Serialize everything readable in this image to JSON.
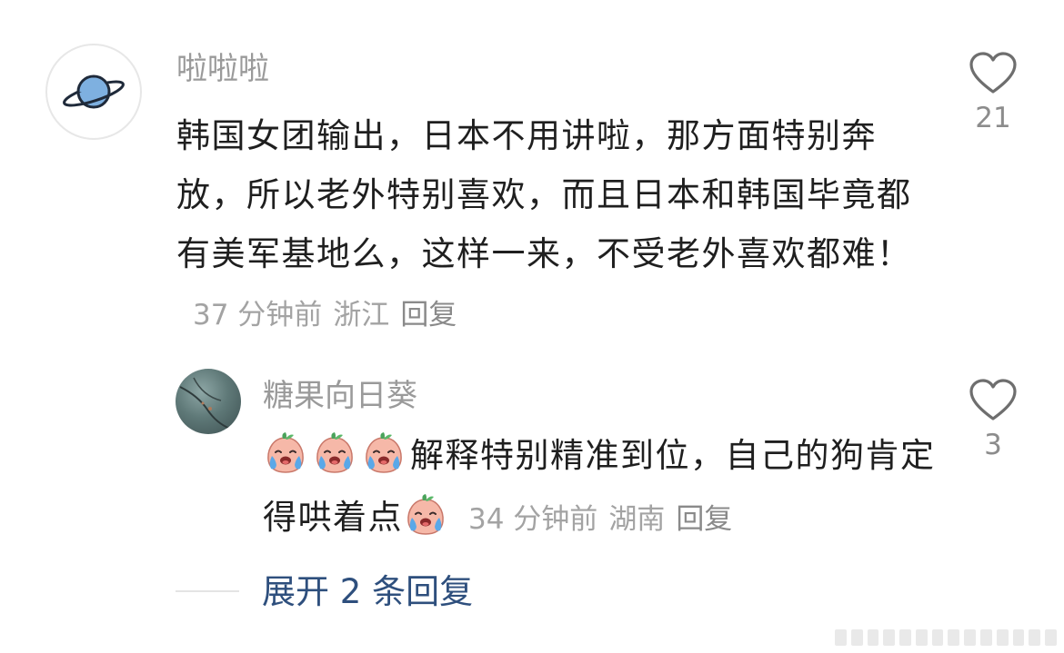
{
  "comment": {
    "username": "啦啦啦",
    "text": "韩国女团输出，日本不用讲啦，那方面特别奔放，所以老外特别喜欢，而且日本和韩国毕竟都有美军基地么，这样一来，不受老外喜欢都难！",
    "time": "37 分钟前",
    "location": "浙江",
    "reply_label": "回复",
    "likes": "21",
    "avatar_icon": "planet-icon",
    "like_icon": "heart-outline-icon"
  },
  "reply": {
    "username": "糖果向日葵",
    "text_before": "解释特别精准到位，自己的狗肯定得哄着点",
    "emoji_name": "crying-peach-emoji",
    "time": "34 分钟前",
    "location": "湖南",
    "reply_label": "回复",
    "likes": "3",
    "like_icon": "heart-outline-icon"
  },
  "expand": {
    "label": "展开 2 条回复"
  },
  "colors": {
    "text": "#1f1f1f",
    "muted": "#9a9a9a",
    "link": "#2e4f7d",
    "planet": "#7eb0e0"
  }
}
